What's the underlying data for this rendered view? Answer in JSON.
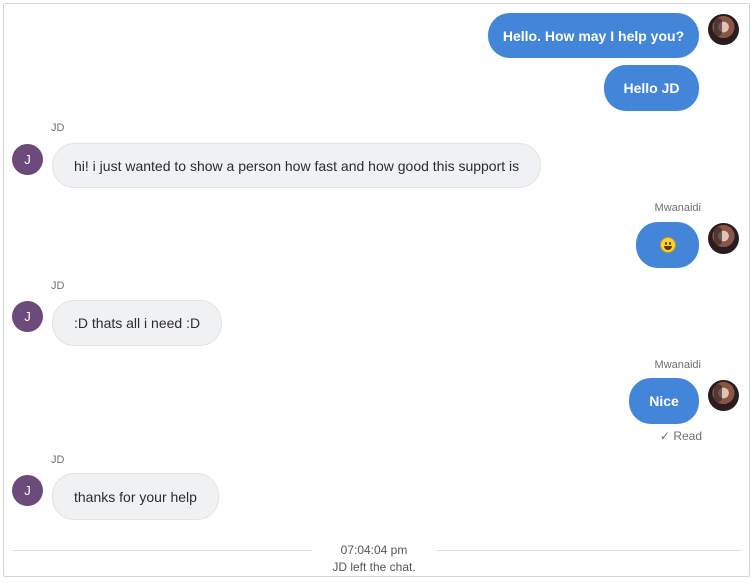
{
  "messages": [
    {
      "text": "Hello. How may I help you?"
    },
    {
      "text": "Hello JD"
    },
    {
      "sender": "JD",
      "avatar_letter": "J",
      "text": "hi! i just wanted to show a person how fast and how good this support is"
    },
    {
      "sender": "Mwanaidi",
      "emoji": "grinning-face-emoji"
    },
    {
      "sender": "JD",
      "avatar_letter": "J",
      "text": ":D thats all i need :D"
    },
    {
      "sender": "Mwanaidi",
      "text": "Nice",
      "status": "Read",
      "status_icon": "checkmark-icon"
    },
    {
      "sender": "JD",
      "avatar_letter": "J",
      "text": "thanks for your help"
    }
  ],
  "event": {
    "time": "07:04:04 pm",
    "text": "JD left the chat."
  },
  "colors": {
    "agent_bubble": "#4285d9",
    "visitor_bubble": "#f0f1f3",
    "visitor_avatar": "#6c4a7c"
  }
}
